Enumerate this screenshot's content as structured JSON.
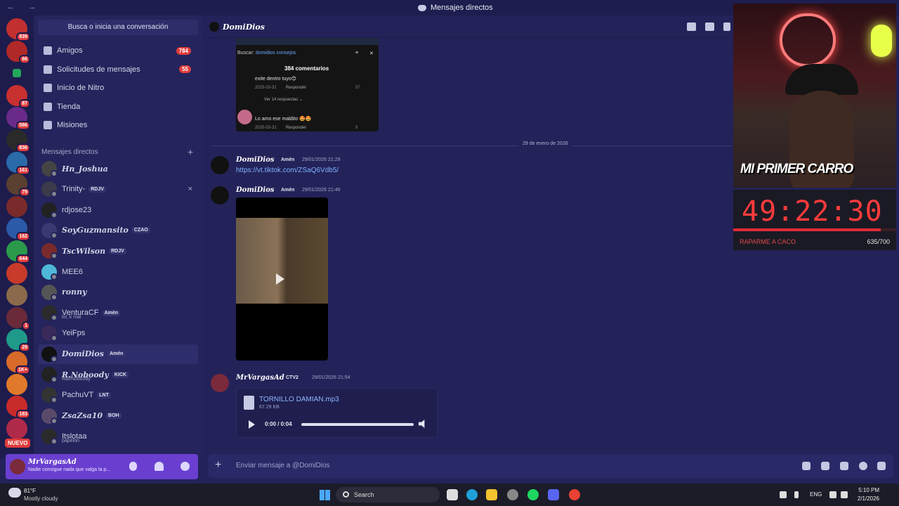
{
  "window": {
    "title": "Mensajes directos",
    "nav": "← →"
  },
  "sidebar": {
    "search_label": "Busca o inicia una conversación",
    "nav": [
      {
        "label": "Amigos",
        "count": "784",
        "icon": "friends-icon"
      },
      {
        "label": "Solicitudes de mensajes",
        "count": "55",
        "icon": "mail-icon"
      },
      {
        "label": "Inicio de Nitro",
        "count": "",
        "icon": "nitro-icon"
      },
      {
        "label": "Tienda",
        "count": "",
        "icon": "shop-icon"
      },
      {
        "label": "Misiones",
        "count": "",
        "icon": "quests-icon"
      }
    ],
    "dm_header": "Mensajes directos",
    "dm_add": "+",
    "dms": [
      {
        "name": "Hn_Joshua",
        "tag": "",
        "sub": "",
        "fancy": true
      },
      {
        "name": "Trinity-",
        "tag": "RDJV",
        "sub": "",
        "fancy": false
      },
      {
        "name": "rdjose23",
        "tag": "",
        "sub": "",
        "fancy": false
      },
      {
        "name": "SoyGuzmansito",
        "tag": "CZAO",
        "sub": "",
        "fancy": true
      },
      {
        "name": "TscWilson",
        "tag": "RDJV",
        "sub": "",
        "fancy": true
      },
      {
        "name": "MEE6",
        "tag": "",
        "sub": "",
        "fancy": false
      },
      {
        "name": "ronny",
        "tag": "",
        "sub": "",
        "fancy": true
      },
      {
        "name": "VenturaCF",
        "tag": "Amén",
        "sub": "lol, k mal",
        "fancy": false
      },
      {
        "name": "YeiFps",
        "tag": "",
        "sub": "",
        "fancy": false
      },
      {
        "name": "DomiDios",
        "tag": "Amén",
        "sub": "",
        "fancy": true
      },
      {
        "name": "R.Noboody",
        "tag": "KICK",
        "sub": "RairNoboody",
        "fancy": true
      },
      {
        "name": "PachuVT",
        "tag": "LNT",
        "sub": "",
        "fancy": false
      },
      {
        "name": "ZsaZsa10",
        "tag": "BOH",
        "sub": "",
        "fancy": true
      },
      {
        "name": "Itslotaa",
        "tag": "",
        "sub": "papelon",
        "fancy": false
      }
    ],
    "close_glyph": "×"
  },
  "rail": {
    "badges": [
      "839",
      "66",
      "",
      "87",
      "586",
      "836",
      "161",
      "79",
      "",
      "162",
      "644",
      "",
      "",
      "1",
      "29",
      "1K+",
      "",
      "183",
      ""
    ],
    "new_label": "NUEVO"
  },
  "user_panel": {
    "name": "MrVargasAd",
    "status": "Nadie consigue nada que valga la p..."
  },
  "chat": {
    "title": "DomiDios",
    "tiktok": {
      "search_prefix": "Buscar:",
      "search_term": "domidios consejos",
      "comments": "384 comentarios",
      "c1_text": "exite dentro tuyo😊",
      "c1_date": "2025-03-31",
      "reply": "Responder",
      "c1_likes": "57",
      "view_replies": "Ver 14 respuestas ⌄",
      "c2_text": "Lo amo ese maldito 🤩🤩",
      "c2_date": "2025-03-31",
      "c2_likes": "5"
    },
    "date_divider": "29 de enero de 2026",
    "msg1": {
      "author": "DomiDios",
      "role": "Amén",
      "time": "29/01/2026 21:29",
      "link": "https://vt.tiktok.com/ZSaQ6Vdb5/"
    },
    "msg2": {
      "author": "DomiDios",
      "role": "Amén",
      "time": "29/01/2026 21:46"
    },
    "msg3": {
      "author": "MrVargasAd",
      "role": "CTV2",
      "time": "29/01/2026 21:54"
    },
    "audio": {
      "name": "TORNILLO DAMIAN.mp3",
      "size": "67.29 KB",
      "time": "0:00 / 0:04"
    },
    "composer_placeholder": "Enviar mensaje a @DomiDios"
  },
  "stream": {
    "overlay_text": "MI PRIMER CARRO",
    "timer": "49:22:30",
    "goal_label": "RAPARME A CACO",
    "goal_count": "635/700",
    "goal_progress": 0.907
  },
  "taskbar": {
    "temp": "81°F",
    "condition": "Mostly cloudy",
    "search": "Search",
    "lang": "ENG",
    "time": "5:10 PM",
    "date": "2/1/2026"
  }
}
